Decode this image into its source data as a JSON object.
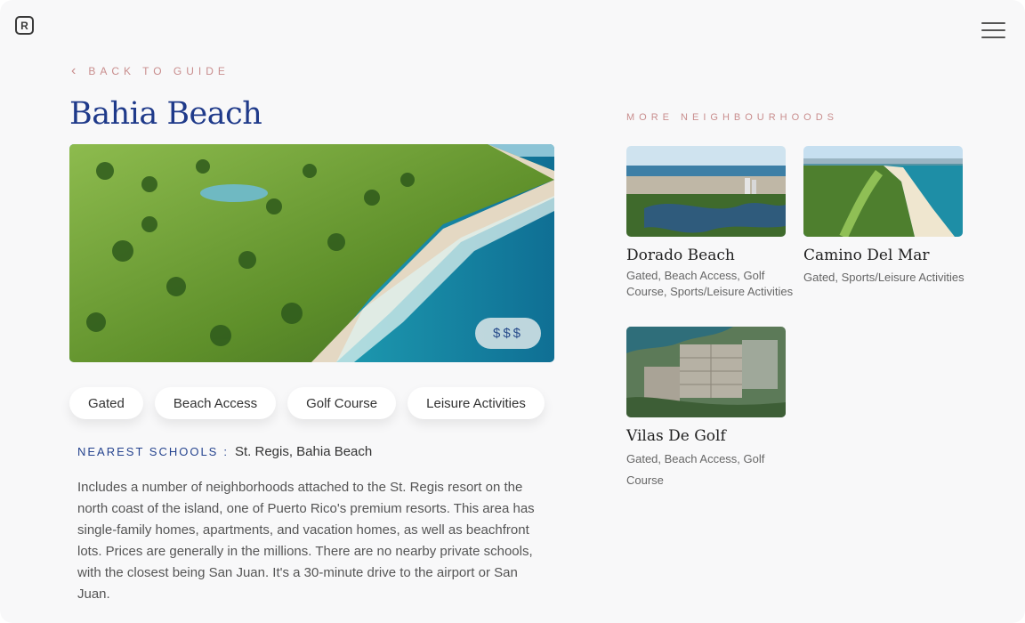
{
  "logo": {
    "letter": "R"
  },
  "back_link": {
    "label": "BACK TO GUIDE"
  },
  "neighbourhood": {
    "title": "Bahia Beach",
    "price": "$$$",
    "tags": [
      "Gated",
      "Beach Access",
      "Golf Course",
      "Leisure Activities"
    ],
    "schools_label": "NEAREST SCHOOLS",
    "schools_colon": ":",
    "schools_value": "St. Regis, Bahia Beach",
    "description": "Includes a number of neighborhoods attached to the St. Regis resort on the north coast of the island, one of Puerto Rico's premium resorts. This area has single-family homes, apartments, and vacation homes, as well as beachfront lots. Prices are generally in the millions. There are no nearby private schools, with the closest being San Juan. It's a 30-minute drive to the airport or San Juan."
  },
  "more": {
    "heading": "MORE NEIGHBOURHOODS",
    "items": [
      {
        "name": "Dorado Beach",
        "features": "Gated, Beach Access, Golf Course, Sports/Leisure Activities"
      },
      {
        "name": "Camino Del Mar",
        "features": "Gated, Sports/Leisure Activities"
      },
      {
        "name": "Vilas De Golf",
        "features": "Gated, Beach Access, Golf Course"
      }
    ]
  },
  "colors": {
    "accent": "#1f3a8a",
    "rose": "#c98e8e",
    "background": "#f8f8f9"
  }
}
